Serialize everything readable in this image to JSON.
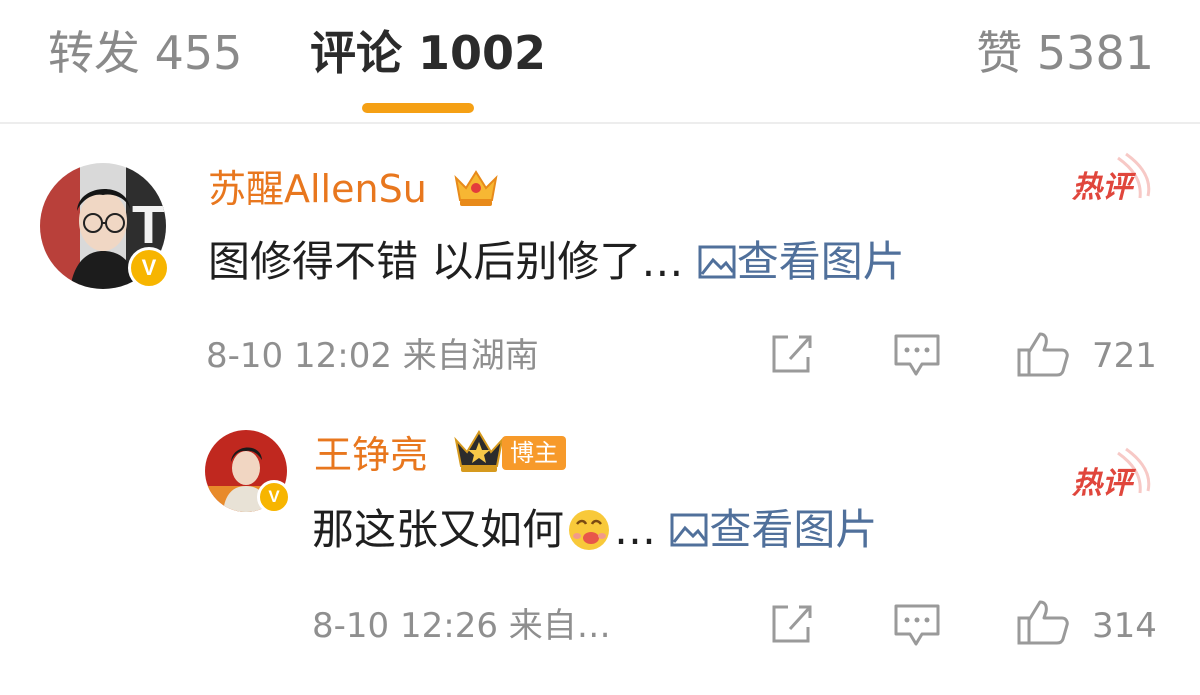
{
  "tabs": {
    "repost": "转发 455",
    "comment": "评论 1002",
    "like": "赞 5381"
  },
  "comments": [
    {
      "username": "苏醒AllenSu",
      "text": "图修得不错 以后别修了…",
      "view_image": "查看图片",
      "hot_label": "热评",
      "time_location": "8-10 12:02 来自湖南",
      "likes": "721",
      "verified_mark": "V"
    },
    {
      "username": "王铮亮",
      "badge": "博主",
      "text": "那这张又如何",
      "ellipsis": "…",
      "view_image": "查看图片",
      "hot_label": "热评",
      "time_location": "8-10 12:26 来自…",
      "likes": "314",
      "verified_mark": "V"
    }
  ],
  "colors": {
    "accent": "#f5a014",
    "username": "#e8771e",
    "link": "#50709b",
    "hot": "#e0463c",
    "meta": "#8f8f8f",
    "verified": "#f7b500"
  },
  "icons": [
    "crown-icon",
    "image-icon",
    "hot-comment-icon",
    "share-icon",
    "reply-icon",
    "thumbs-up-icon",
    "emoji-icon",
    "verified-icon"
  ]
}
